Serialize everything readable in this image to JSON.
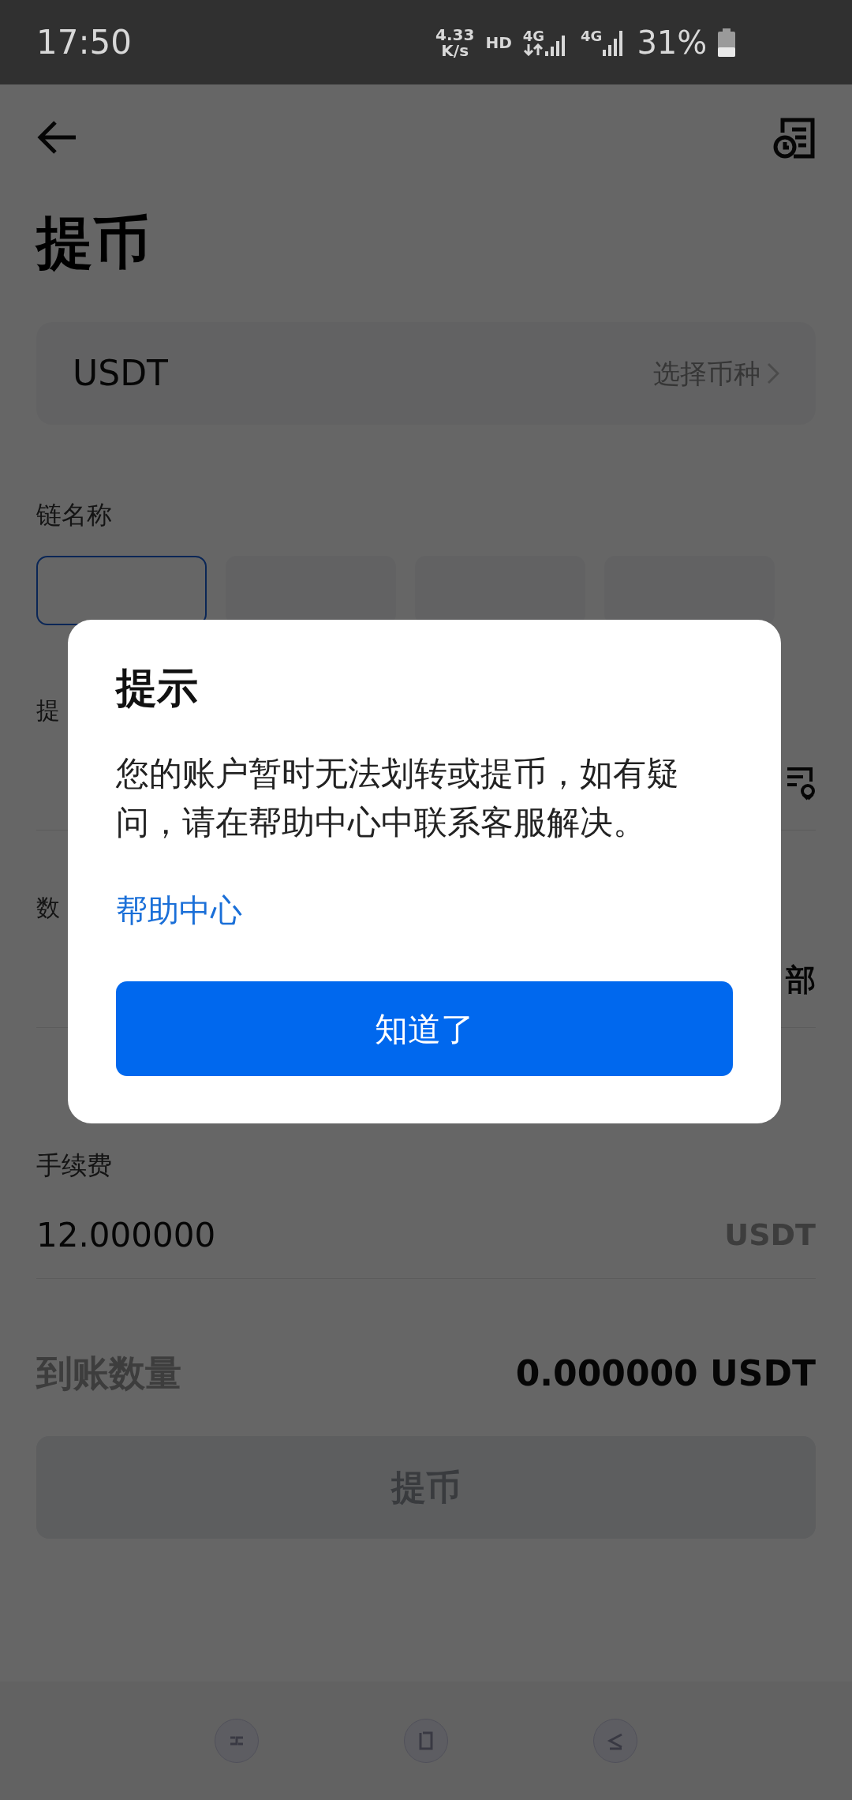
{
  "status_bar": {
    "time": "17:50",
    "speed_value": "4.33",
    "speed_unit": "K/s",
    "hd": "HD",
    "network_1": "4G",
    "network_2": "4G",
    "battery": "31%"
  },
  "page": {
    "title": "提币",
    "coin": {
      "value": "USDT",
      "action": "选择币种"
    },
    "chain": {
      "label": "链名称",
      "chips": [
        {
          "selected": true
        },
        {
          "selected": false
        },
        {
          "selected": false
        },
        {
          "selected": false
        }
      ]
    },
    "address": {
      "label": "提"
    },
    "amount": {
      "label": "数",
      "all_button": "部"
    },
    "fee": {
      "label": "手续费",
      "value": "12.000000",
      "unit": "USDT"
    },
    "receive": {
      "label": "到账数量",
      "value": "0.000000 USDT"
    },
    "submit": {
      "label": "提币",
      "disabled": true
    }
  },
  "dialog": {
    "title": "提示",
    "message": "您的账户暂时无法划转或提币，如有疑问，请在帮助中心中联系客服解决。",
    "link": "帮助中心",
    "confirm": "知道了"
  }
}
